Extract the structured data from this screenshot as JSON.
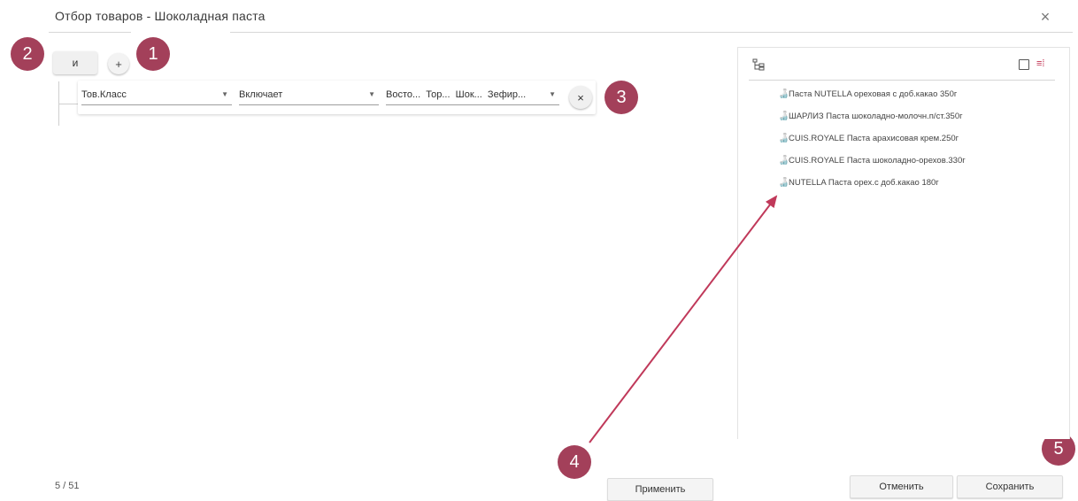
{
  "dialog": {
    "title": "Отбор товаров - Шоколадная паста",
    "close_symbol": "×"
  },
  "badges": [
    "1",
    "2",
    "3",
    "4",
    "5"
  ],
  "filter": {
    "logic_label": "и",
    "add_symbol": "+",
    "condition": {
      "field": "Тов.Класс",
      "operator": "Включает",
      "values": "Восто...  Тор...  Шок...  Зефир...",
      "clear_symbol": "×"
    }
  },
  "results": {
    "tree_icon": "tree-icon",
    "items": [
      "Паста NUTELLA ореховая с доб.какао 350г",
      "ШАРЛИЗ Паста шоколадно-молочн.п/ст.350г",
      "CUIS.ROYALE Паста арахисовая крем.250г",
      "CUIS.ROYALE Паста шоколадно-орехов.330г",
      "NUTELLA Паста орех.с доб.какао 180г"
    ]
  },
  "footer": {
    "counter": "5 / 51",
    "apply_label": "Применить",
    "cancel_label": "Отменить",
    "save_label": "Сохранить"
  },
  "colors": {
    "badge": "#a3405a",
    "arrow": "#c0395a"
  }
}
